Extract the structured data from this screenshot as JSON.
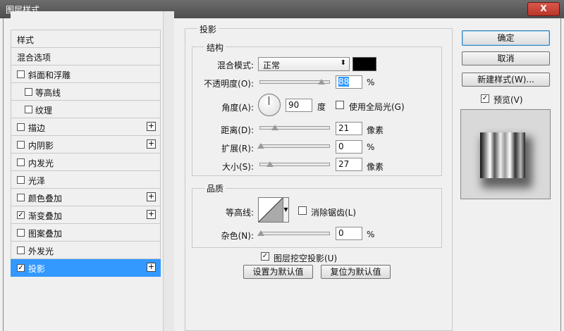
{
  "window": {
    "title": "图层样式",
    "close_label": "X"
  },
  "style_list": {
    "items": [
      {
        "label": "样式",
        "type": "head",
        "checked": false,
        "plus": false
      },
      {
        "label": "混合选项",
        "type": "head",
        "checked": false,
        "plus": false
      },
      {
        "label": "斜面和浮雕",
        "type": "item",
        "checked": false,
        "plus": false
      },
      {
        "label": "等高线",
        "type": "sub",
        "checked": false,
        "plus": false
      },
      {
        "label": "纹理",
        "type": "sub",
        "checked": false,
        "plus": false
      },
      {
        "label": "描边",
        "type": "item",
        "checked": false,
        "plus": true
      },
      {
        "label": "内阴影",
        "type": "item",
        "checked": false,
        "plus": true
      },
      {
        "label": "内发光",
        "type": "item",
        "checked": false,
        "plus": false
      },
      {
        "label": "光泽",
        "type": "item",
        "checked": false,
        "plus": false
      },
      {
        "label": "颜色叠加",
        "type": "item",
        "checked": false,
        "plus": true
      },
      {
        "label": "渐变叠加",
        "type": "item",
        "checked": true,
        "plus": true
      },
      {
        "label": "图案叠加",
        "type": "item",
        "checked": false,
        "plus": false
      },
      {
        "label": "外发光",
        "type": "item",
        "checked": false,
        "plus": false
      },
      {
        "label": "投影",
        "type": "item",
        "checked": true,
        "plus": true,
        "selected": true
      }
    ]
  },
  "drop_shadow": {
    "section_title": "投影",
    "structure": {
      "title": "结构",
      "blend_mode_label": "混合模式:",
      "blend_mode_value": "正常",
      "shadow_color": "#000000",
      "opacity_label": "不透明度(O):",
      "opacity_value": "88",
      "opacity_unit": "%",
      "angle_label": "角度(A):",
      "angle_value": "90",
      "angle_unit": "度",
      "global_light_label": "使用全局光(G)",
      "global_light_checked": false,
      "distance_label": "距离(D):",
      "distance_value": "21",
      "distance_unit": "像素",
      "spread_label": "扩展(R):",
      "spread_value": "0",
      "spread_unit": "%",
      "size_label": "大小(S):",
      "size_value": "27",
      "size_unit": "像素"
    },
    "quality": {
      "title": "品质",
      "contour_label": "等高线:",
      "antialias_label": "消除锯齿(L)",
      "antialias_checked": false,
      "noise_label": "杂色(N):",
      "noise_value": "0",
      "noise_unit": "%"
    },
    "knockout_label": "图层挖空投影(U)",
    "knockout_checked": true,
    "make_default_label": "设置为默认值",
    "reset_default_label": "复位为默认值"
  },
  "right_panel": {
    "ok_label": "确定",
    "cancel_label": "取消",
    "new_style_label": "新建样式(W)...",
    "preview_label": "预览(V)",
    "preview_checked": true
  }
}
